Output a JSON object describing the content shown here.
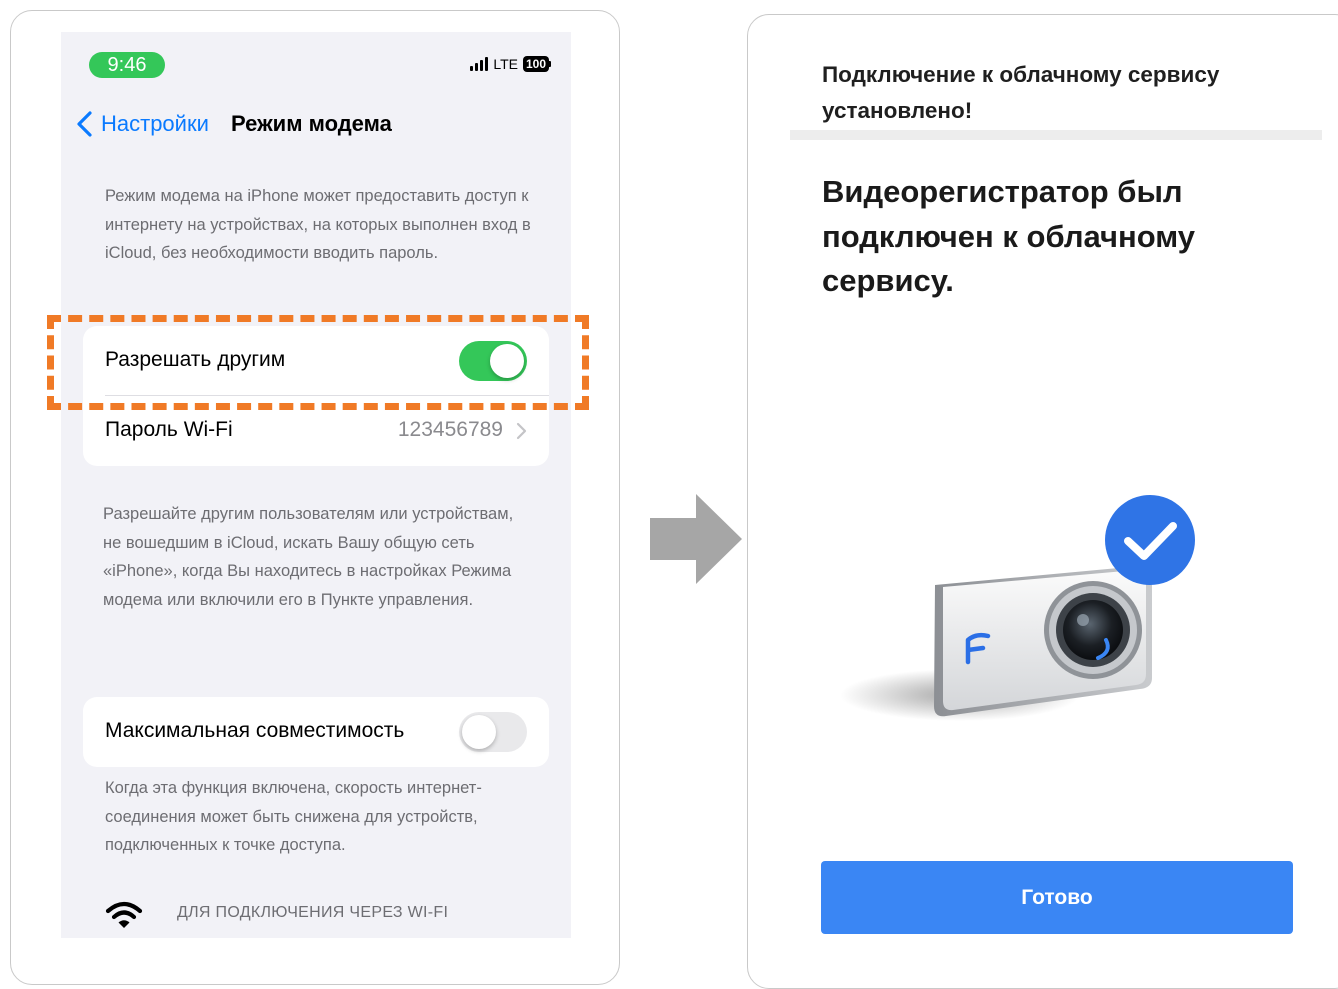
{
  "left_screen": {
    "status_bar": {
      "time": "9:46",
      "network": "LTE",
      "battery": "100",
      "time_pill_color": "#34c759"
    },
    "nav": {
      "back_label": "Настройки",
      "title": "Режим модема",
      "back_icon": "chevron-left-icon"
    },
    "intro_text": "Режим модема на iPhone может предоставить доступ к интернету на устройствах, на которых выполнен вход в iCloud, без необходимости вводить пароль.",
    "allow_others": {
      "label": "Разрешать другим",
      "enabled": true
    },
    "wifi_password": {
      "label": "Пароль Wi-Fi",
      "value": "123456789"
    },
    "allow_note": "Разрешайте другим пользователям или устройствам, не вошедшим в iCloud, искать Вашу общую сеть «iPhone», когда Вы находитесь в настройках Режима модема или включили его в Пункте управления.",
    "max_compatibility": {
      "label": "Максимальная совместимость",
      "enabled": false
    },
    "compat_note": "Когда эта функция включена, скорость интернет-соединения может быть снижена для устройств, подключенных к точке доступа.",
    "wifi_section": {
      "icon": "wifi-icon",
      "caption": "ДЛЯ ПОДКЛЮЧЕНИЯ ЧЕРЕЗ WI-FI"
    },
    "highlight_color": "#f07a26"
  },
  "arrow": {
    "icon": "arrow-right-icon",
    "color": "#a6a6a6"
  },
  "right_screen": {
    "header_title": "Подключение к облачному сервису установлено!",
    "main_message": "Видеорегистратор был подключен к облачному сервису.",
    "illustration": "dashcam-connected-illustration",
    "done_button": "Готово",
    "accent_color": "#3a86f4"
  }
}
